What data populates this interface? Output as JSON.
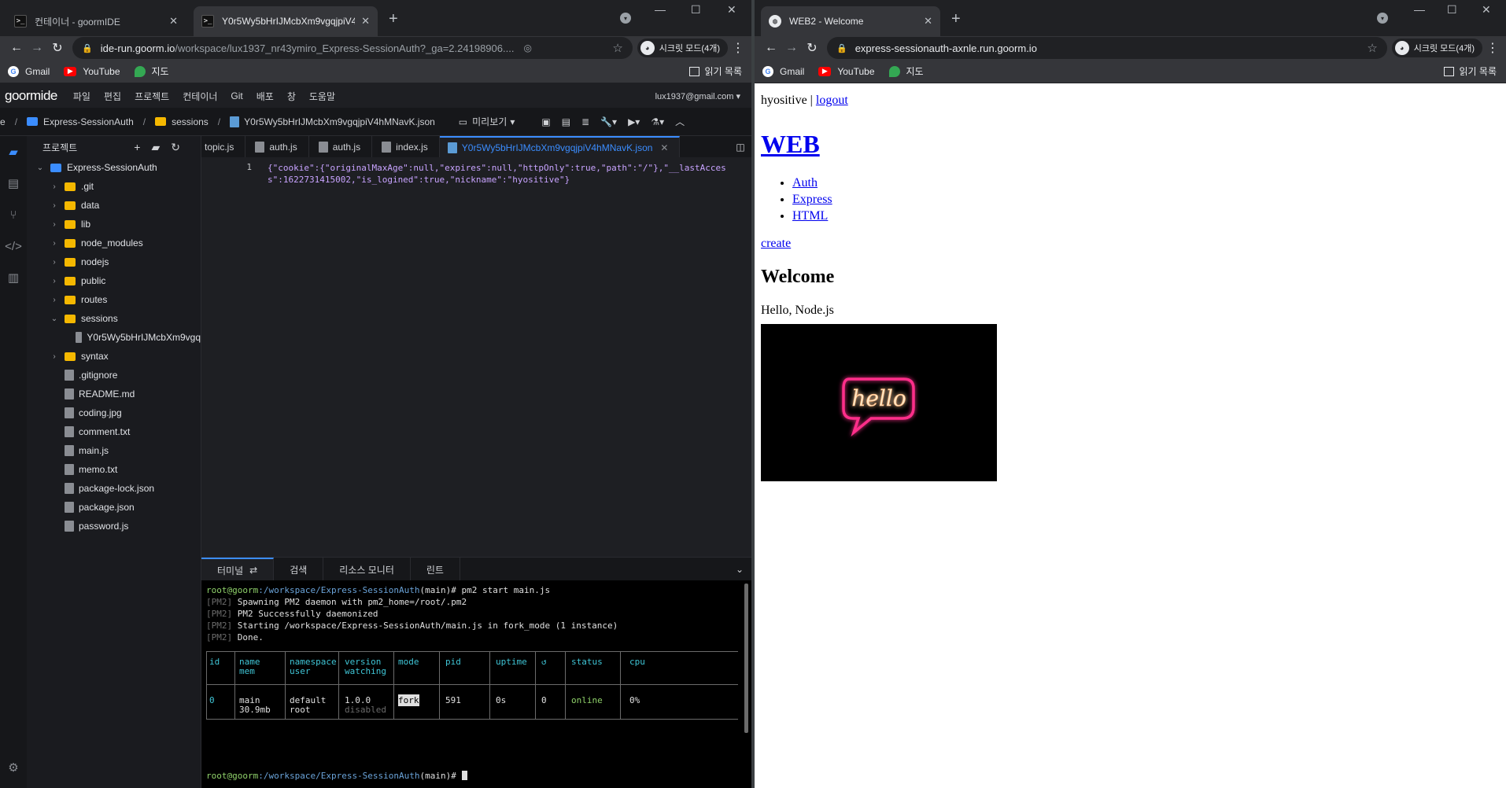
{
  "left_browser": {
    "tabs": [
      {
        "title": "컨테이너 - goormIDE",
        "active": false
      },
      {
        "title": "Y0r5Wy5bHrIJMcbXm9vgqjpiV4",
        "active": true
      }
    ],
    "url_host": "ide-run.goorm.io",
    "url_path": "/workspace/lux1937_nr43ymiro_Express-SessionAuth?_ga=2.24198906....",
    "incognito_label": "시크릿 모드(4개)",
    "bookmarks": [
      "Gmail",
      "YouTube",
      "지도"
    ],
    "reading_list": "읽기 목록"
  },
  "ide": {
    "logo": "goormide",
    "menu": [
      "파일",
      "편집",
      "프로젝트",
      "컨테이너",
      "Git",
      "배포",
      "창",
      "도움말"
    ],
    "account": "lux1937@gmail.com",
    "breadcrumb": [
      "e",
      "Express-SessionAuth",
      "sessions",
      "Y0r5Wy5bHrIJMcbXm9vgqjpiV4hMNavK.json"
    ],
    "preview_label": "미리보기",
    "explorer_title": "프로젝트",
    "tree": [
      {
        "label": "Express-SessionAuth",
        "kind": "root",
        "depth": 0,
        "chev": "v"
      },
      {
        "label": ".git",
        "kind": "folder",
        "depth": 1,
        "chev": ">"
      },
      {
        "label": "data",
        "kind": "folder",
        "depth": 1,
        "chev": ">"
      },
      {
        "label": "lib",
        "kind": "folder",
        "depth": 1,
        "chev": ">"
      },
      {
        "label": "node_modules",
        "kind": "folder",
        "depth": 1,
        "chev": ">"
      },
      {
        "label": "nodejs",
        "kind": "folder",
        "depth": 1,
        "chev": ">"
      },
      {
        "label": "public",
        "kind": "folder",
        "depth": 1,
        "chev": ">"
      },
      {
        "label": "routes",
        "kind": "folder",
        "depth": 1,
        "chev": ">"
      },
      {
        "label": "sessions",
        "kind": "folder",
        "depth": 1,
        "chev": "v"
      },
      {
        "label": "Y0r5Wy5bHrIJMcbXm9vgq",
        "kind": "file",
        "depth": 2,
        "chev": ""
      },
      {
        "label": "syntax",
        "kind": "folder",
        "depth": 1,
        "chev": ">"
      },
      {
        "label": ".gitignore",
        "kind": "file",
        "depth": 1,
        "chev": ""
      },
      {
        "label": "README.md",
        "kind": "file",
        "depth": 1,
        "chev": ""
      },
      {
        "label": "coding.jpg",
        "kind": "file",
        "depth": 1,
        "chev": ""
      },
      {
        "label": "comment.txt",
        "kind": "file",
        "depth": 1,
        "chev": ""
      },
      {
        "label": "main.js",
        "kind": "file",
        "depth": 1,
        "chev": ""
      },
      {
        "label": "memo.txt",
        "kind": "file",
        "depth": 1,
        "chev": ""
      },
      {
        "label": "package-lock.json",
        "kind": "file",
        "depth": 1,
        "chev": ""
      },
      {
        "label": "package.json",
        "kind": "file",
        "depth": 1,
        "chev": ""
      },
      {
        "label": "password.js",
        "kind": "file",
        "depth": 1,
        "chev": ""
      }
    ],
    "editor_tabs": [
      {
        "label": "topic.js",
        "active": false
      },
      {
        "label": "auth.js",
        "active": false
      },
      {
        "label": "auth.js",
        "active": false
      },
      {
        "label": "index.js",
        "active": false
      },
      {
        "label": "Y0r5Wy5bHrIJMcbXm9vgqjpiV4hMNavK.json",
        "active": true
      }
    ],
    "line_number": "1",
    "code": "{\"cookie\":{\"originalMaxAge\":null,\"expires\":null,\"httpOnly\":true,\"path\":\"/\"},\"__lastAccess\":1622731415002,\"is_logined\":true,\"nickname\":\"hyositive\"}",
    "bottom_tabs": [
      "터미널",
      "검색",
      "리소스 모니터",
      "린트"
    ],
    "terminal": {
      "prompt_user": "root@goorm",
      "prompt_path": ":/workspace/Express-SessionAuth",
      "prompt_branch": "(main)",
      "command": "# pm2 start main.js",
      "prompt_end": "#",
      "pm2_tag": "[PM2]",
      "pm2_lines": [
        "Spawning PM2 daemon with pm2_home=/root/.pm2",
        "PM2 Successfully daemonized",
        "Starting /workspace/Express-SessionAuth/main.js in fork_mode (1 instance)",
        "Done."
      ],
      "table_headers": [
        "id",
        "name",
        "namespace",
        "version",
        "mode",
        "pid",
        "uptime",
        "↺",
        "status",
        "cpu"
      ],
      "table_headers_2": [
        "",
        "mem",
        "user",
        "watching",
        "",
        "",
        "",
        "",
        "",
        ""
      ],
      "table_row": [
        "0",
        "main",
        "default",
        "1.0.0",
        "fork",
        "591",
        "0s",
        "0",
        "online",
        "0%"
      ],
      "table_row_2": [
        "",
        "30.9mb",
        "root",
        "disabled",
        "",
        "",
        "",
        "",
        "",
        ""
      ]
    }
  },
  "right_browser": {
    "tab_title": "WEB2 - Welcome",
    "url": "express-sessionauth-axnle.run.goorm.io",
    "incognito_label": "시크릿 모드(4개)",
    "bookmarks": [
      "Gmail",
      "YouTube",
      "지도"
    ],
    "reading_list": "읽기 목록",
    "page": {
      "username": "hyositive",
      "separator": "|",
      "logout": "logout",
      "title": "WEB",
      "nav": [
        "Auth",
        "Express",
        "HTML"
      ],
      "create": "create",
      "heading": "Welcome",
      "body": "Hello, Node.js",
      "image_text": "hello"
    }
  },
  "colors": {
    "accent": "#3b8dff",
    "folder": "#f5b800",
    "link": "#0000ee",
    "neon_pink": "#ff2d8a"
  }
}
